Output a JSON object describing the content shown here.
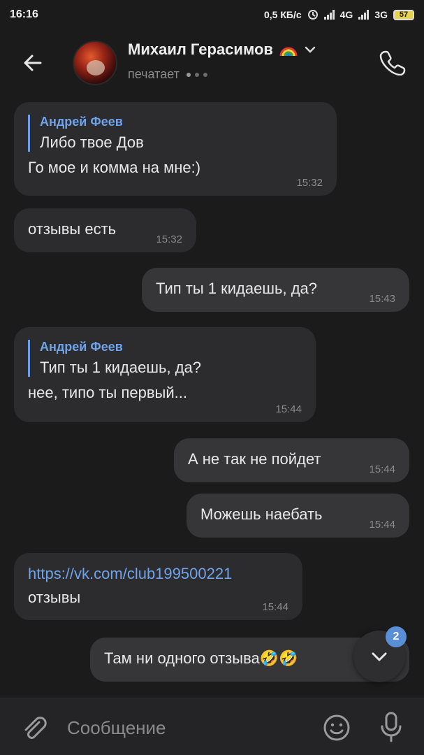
{
  "status_bar": {
    "time": "16:16",
    "speed": "0,5 КБ/с",
    "net1": "4G",
    "net2": "3G",
    "battery": "57"
  },
  "header": {
    "name": "Михаил Герасимов",
    "status": "печатает",
    "icons": [
      "back-arrow-icon",
      "rainbow-emoji",
      "chevron-down-icon",
      "phone-icon"
    ]
  },
  "messages": [
    {
      "direction": "in",
      "reply_author": "Андрей Феев",
      "reply_text": "Либо твое Дов",
      "text": "Го мое и комма на мне:)",
      "time": "15:32"
    },
    {
      "direction": "in",
      "text": "отзывы есть",
      "time": "15:32"
    },
    {
      "direction": "out",
      "text": "Тип ты 1 кидаешь, да?",
      "time": "15:43"
    },
    {
      "direction": "in",
      "reply_author": "Андрей Феев",
      "reply_text": "Тип ты 1 кидаешь, да?",
      "text": "нее, типо ты первый...",
      "time": "15:44"
    },
    {
      "direction": "out",
      "text": "А не так не пойдет",
      "time": "15:44"
    },
    {
      "direction": "out",
      "text": "Можешь наебать",
      "time": "15:44"
    },
    {
      "direction": "in",
      "link": "https://vk.com/club199500221",
      "text": "отзывы",
      "time": "15:44"
    },
    {
      "direction": "out",
      "text": "Там ни одного отзыва",
      "emoji": "🤣🤣"
    }
  ],
  "scroll_down": {
    "unread_count": "2"
  },
  "composer": {
    "placeholder": "Сообщение"
  },
  "colors": {
    "accent": "#6fa3ea",
    "badge": "#5a8fd8",
    "bg": "#1b1b1c",
    "bubble_in": "#2c2c2e",
    "bubble_out": "#363638"
  }
}
